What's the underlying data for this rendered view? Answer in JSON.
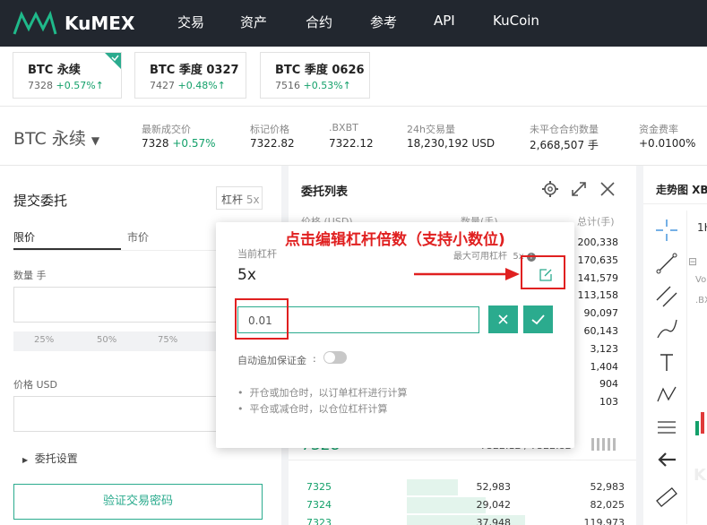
{
  "topnav": {
    "brand": "KuMEX",
    "items": [
      "交易",
      "资产",
      "合约",
      "参考",
      "API",
      "KuCoin"
    ]
  },
  "cards": [
    {
      "title": "BTC 永续",
      "price": "7328",
      "change": "+0.57%",
      "arrow": "↑"
    },
    {
      "title": "BTC 季度 0327",
      "price": "7427",
      "change": "+0.48%",
      "arrow": "↑"
    },
    {
      "title": "BTC 季度 0626",
      "price": "7516",
      "change": "+0.53%",
      "arrow": "↑"
    }
  ],
  "market": {
    "symbol": "BTC 永续",
    "stats": [
      {
        "label": "最新成交价",
        "value": "7328",
        "extra": "+0.57%"
      },
      {
        "label": "标记价格",
        "value": "7322.82"
      },
      {
        "label": ".BXBT",
        "value": "7322.12"
      },
      {
        "label": "24h交易量",
        "value": "18,230,192 USD"
      },
      {
        "label": "未平仓合约数量",
        "value": "2,668,507 手"
      },
      {
        "label": "资金费率",
        "value": "+0.0100%"
      }
    ]
  },
  "order_panel": {
    "title": "提交委托",
    "leverage_btn": "杠杆",
    "leverage_val": "5x",
    "tabs": [
      "限价",
      "市价"
    ],
    "qty_label": "数量 手",
    "pcts": [
      "25%",
      "50%",
      "75%"
    ],
    "price_label": "价格 USD",
    "settings": "委托设置",
    "submit": "验证交易密码"
  },
  "orderbook": {
    "title": "委托列表",
    "headers": [
      "价格 (USD)",
      "数量(手)",
      "总计(手)"
    ],
    "totals_top": [
      "200,338",
      "170,635",
      "141,579",
      "113,158",
      "90,097",
      "60,143",
      "3,123",
      "1,404",
      "904",
      "103"
    ],
    "mid_price": "7328",
    "mid_right": "7322.12 / 7322.82",
    "bids": [
      {
        "price": "7325",
        "qty": "52,983",
        "total": "52,983",
        "fill": 0.26
      },
      {
        "price": "7324",
        "qty": "29,042",
        "total": "82,025",
        "fill": 0.4
      },
      {
        "price": "7323",
        "qty": "37,948",
        "total": "119,973",
        "fill": 0.6
      }
    ]
  },
  "chart_panel": {
    "title": "走势图 XBT",
    "tab": "1H",
    "lines": [
      "Volu",
      ".BXB"
    ],
    "watermark": "KU"
  },
  "popup": {
    "current_label": "当前杠杆",
    "current_value": "5x",
    "max_label": "最大可用杠杆",
    "max_value": "5x",
    "input_value": "0.01",
    "auto_label": "自动追加保证金",
    "notes": [
      "开仓或加仓时，以订单杠杆进行计算",
      "平仓或减仓时，以仓位杠杆计算"
    ]
  },
  "annotation": {
    "text": "点击编辑杠杆倍数（支持小数位)"
  },
  "colors": {
    "green": "#13a06a",
    "red": "#e02020",
    "teal": "#2bab8e",
    "nav": "#22272f"
  }
}
